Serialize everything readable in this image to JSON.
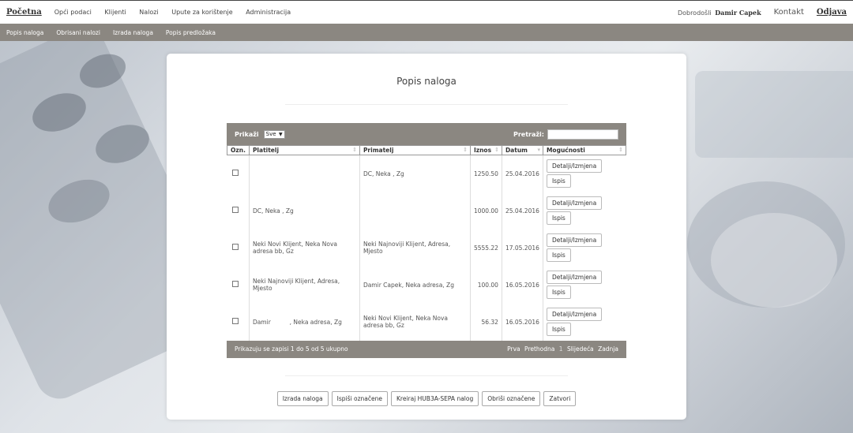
{
  "topbar": {
    "brand": "Početna",
    "nav": [
      "Opći podaci",
      "Klijenti",
      "Nalozi",
      "Upute za korištenje",
      "Administracija"
    ],
    "welcome_label": "Dobrodošli",
    "user_name": "Damir Capek",
    "contact": "Kontakt",
    "logout": "Odjava"
  },
  "subnav": [
    "Popis naloga",
    "Obrisani nalozi",
    "Izrada naloga",
    "Popis predložaka"
  ],
  "page": {
    "title": "Popis naloga"
  },
  "table": {
    "show_label": "Prikaži",
    "show_value": "Sve",
    "search_label": "Pretraži:",
    "search_value": "",
    "columns": [
      "Ozn.",
      "Platitelj",
      "Primatelj",
      "Iznos",
      "Datum",
      "Mogućnosti"
    ],
    "rows": [
      {
        "platitelj": "",
        "primatelj": "DC, Neka , Zg",
        "iznos": "1250.50",
        "datum": "25.04.2016"
      },
      {
        "platitelj": "DC, Neka , Zg",
        "primatelj": "",
        "iznos": "1000.00",
        "datum": "25.04.2016"
      },
      {
        "platitelj": "Neki Novi Klijent, Neka Nova adresa bb, Gz",
        "primatelj": "Neki Najnoviji Klijent, Adresa, Mjesto",
        "iznos": "5555.22",
        "datum": "17.05.2016"
      },
      {
        "platitelj": "Neki Najnoviji Klijent, Adresa, Mjesto",
        "primatelj": "Damir Capek, Neka adresa, Zg",
        "iznos": "100.00",
        "datum": "16.05.2016"
      },
      {
        "platitelj": "Damir          , Neka adresa, Zg",
        "primatelj": "Neki Novi Klijent, Neka Nova adresa bb, Gz",
        "iznos": "56.32",
        "datum": "16.05.2016"
      }
    ],
    "row_button_edit": "Detalji/Izmjena",
    "row_button_print": "Ispis",
    "footer_info": "Prikazuju se zapisi 1 do 5 od 5 ukupno",
    "pager": {
      "first": "Prva",
      "prev": "Prethodna",
      "current": "1",
      "next": "Slijedeća",
      "last": "Zadnja"
    }
  },
  "actions": [
    "Izrada naloga",
    "Ispiši označene",
    "Kreiraj HUB3A-SEPA nalog",
    "Obriši označene",
    "Zatvori"
  ]
}
